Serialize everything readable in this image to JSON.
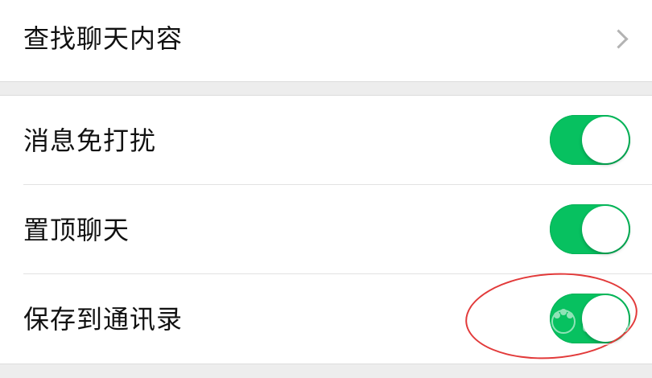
{
  "settings": {
    "search_chat": {
      "label": "查找聊天内容"
    },
    "toggles": [
      {
        "label": "消息免打扰",
        "enabled": true
      },
      {
        "label": "置顶聊天",
        "enabled": true
      },
      {
        "label": "保存到通讯录",
        "enabled": true
      }
    ]
  },
  "colors": {
    "toggle_on": "#07c160",
    "annotation": "#e23a3a",
    "background": "#ededed"
  },
  "icons": {
    "search_chat_arrow": "chevron-right-icon"
  }
}
